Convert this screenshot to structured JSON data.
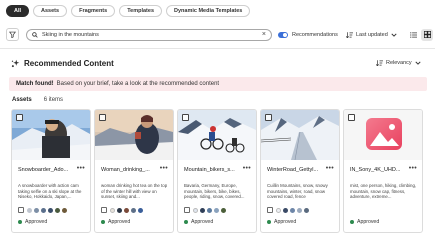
{
  "tabs": [
    {
      "label": "All",
      "active": true
    },
    {
      "label": "Assets",
      "active": false
    },
    {
      "label": "Fragments",
      "active": false
    },
    {
      "label": "Templates",
      "active": false
    },
    {
      "label": "Dynamic Media Templates",
      "active": false
    }
  ],
  "search": {
    "value": "Skiing in the mountains"
  },
  "recommendations": {
    "label": "Recommendations",
    "enabled": true
  },
  "sort": {
    "label": "Last updated"
  },
  "section": {
    "title": "Recommended Content",
    "sort_label": "Relevancy"
  },
  "banner": {
    "bold": "Match found!",
    "text": "Based on your brief, take a look at the recommended content"
  },
  "assets_header": {
    "label": "Assets",
    "count": "6 items"
  },
  "cards": [
    {
      "name": "Snowboarder_Ado...",
      "description": "A snowboarder with action cam taking selfie on a ski slope at the Niseko, Hokkaido, Japan,...",
      "status": "Approved",
      "colors": [
        "#bfc5cf",
        "#7d8fa6",
        "#5b6f8c",
        "#3c4f6b",
        "#4a5a3e",
        "#6e5a3a"
      ],
      "thumb": "snowboard"
    },
    {
      "name": "Woman_drinking_...",
      "description": "woman drinking hot tea on the top of the winter hill with view on sunset, skiing and...",
      "status": "Approved",
      "colors": [
        "#e7e3dc",
        "#2e3a4a",
        "#7a4a3a",
        "#5d6f88",
        "#3b5f9a"
      ],
      "thumb": "tea"
    },
    {
      "name": "Mountain_bikers_s...",
      "description": "Bavaria, Germany, Europe, mountain, bikers, bike, bikes, people, riding, snow, covered...",
      "status": "Approved",
      "colors": [
        "#dfe6ef",
        "#2f3f58",
        "#5b7a9e",
        "#8aa2bd",
        "#4b5f3a"
      ],
      "thumb": "bikers"
    },
    {
      "name": "WinterRoad_Gettyl...",
      "description": "Cuillin Mountains, snow, snowy mountains, winter, road, snow covered road, fence",
      "status": "Approved",
      "colors": [
        "#eef1f5",
        "#3a4a66",
        "#6d86a8",
        "#9aa9bd",
        "#5a6a7e"
      ],
      "thumb": "road"
    },
    {
      "name": "IN_Sony_4K_UHD...",
      "description": "mist, one person, hiking, climbing, mountain, snow cap, fitness, adventure, extreme...",
      "status": "Approved",
      "colors": [],
      "thumb": "placeholder"
    }
  ]
}
